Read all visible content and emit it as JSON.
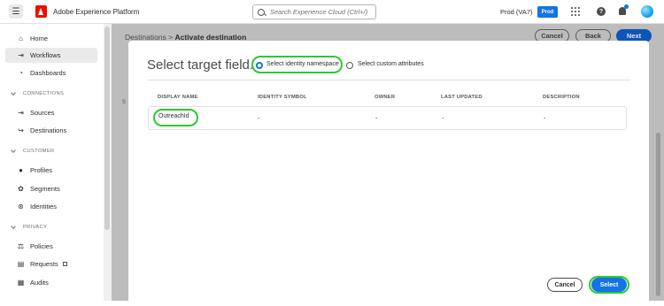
{
  "header": {
    "app_title": "Adobe Experience Platform",
    "search_placeholder": "Search Experience Cloud (Ctrl+/)",
    "org": "Prod (VA7)",
    "sandbox_badge": "Prod",
    "help_glyph": "?"
  },
  "sidebar": {
    "items": [
      {
        "label": "Home",
        "icon": "home-icon"
      },
      {
        "label": "Workflows",
        "icon": "workflows-icon"
      },
      {
        "label": "Dashboards",
        "icon": "dashboards-icon"
      }
    ],
    "sections": {
      "connections": "CONNECTIONS",
      "customer": "CUSTOMER",
      "privacy": "PRIVACY"
    },
    "connections_items": [
      {
        "label": "Sources",
        "icon": "sources-icon"
      },
      {
        "label": "Destinations",
        "icon": "destinations-icon"
      }
    ],
    "customer_items": [
      {
        "label": "Profiles",
        "icon": "profiles-icon"
      },
      {
        "label": "Segments",
        "icon": "segments-icon"
      },
      {
        "label": "Identities",
        "icon": "identities-icon"
      }
    ],
    "privacy_items": [
      {
        "label": "Policies",
        "icon": "policies-icon"
      },
      {
        "label": "Requests",
        "icon": "requests-icon"
      },
      {
        "label": "Audits",
        "icon": "audits-icon"
      }
    ]
  },
  "background": {
    "breadcrumb_parent": "Destinations",
    "breadcrumb_sep": ">",
    "breadcrumb_current": "Activate destination",
    "cancel_label": "Cancel",
    "back_label": "Back",
    "next_label": "Next",
    "partial_letter": "S"
  },
  "modal": {
    "title": "Select target field.",
    "radio_identity_label": "Select identity namespace",
    "radio_custom_label": "Select custom attributes",
    "columns": [
      "DISPLAY NAME",
      "IDENTITY SYMBOL",
      "OWNER",
      "LAST UPDATED",
      "DESCRIPTION"
    ],
    "row": {
      "display_name": "OutreachId",
      "identity_symbol": "-",
      "owner": "-",
      "last_updated": "-",
      "description": "-"
    },
    "cancel_label": "Cancel",
    "select_label": "Select"
  },
  "colors": {
    "accent": "#1473e6",
    "highlight": "#2dc92d",
    "adobe_red": "#eb1000"
  }
}
